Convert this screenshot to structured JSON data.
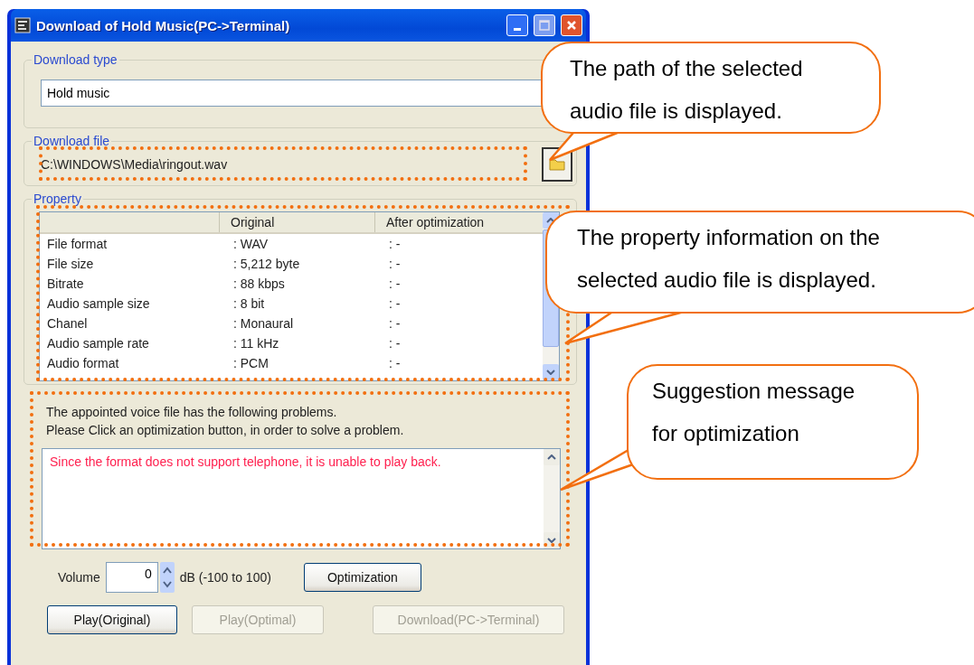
{
  "window": {
    "title": "Download of Hold Music(PC->Terminal)"
  },
  "download_type": {
    "label": "Download type",
    "value": "Hold music"
  },
  "download_file": {
    "label": "Download file",
    "path": "C:\\WINDOWS\\Media\\ringout.wav"
  },
  "property": {
    "label": "Property",
    "columns": [
      "Original",
      "After optimization"
    ],
    "rows": [
      {
        "name": "File format",
        "original": ": WAV",
        "after": ": -"
      },
      {
        "name": "File size",
        "original": ": 5,212 byte",
        "after": ": -"
      },
      {
        "name": "Bitrate",
        "original": ": 88 kbps",
        "after": ": -"
      },
      {
        "name": "Audio sample size",
        "original": ": 8 bit",
        "after": ": -"
      },
      {
        "name": "Chanel",
        "original": ": Monaural",
        "after": ": -"
      },
      {
        "name": "Audio sample rate",
        "original": ": 11 kHz",
        "after": ": -"
      },
      {
        "name": "Audio format",
        "original": ": PCM",
        "after": ": -"
      }
    ]
  },
  "message": {
    "lines": [
      "The appointed voice file has the following problems.",
      "Please Click an optimization button, in order to solve a problem."
    ],
    "problem": "Since the format does not support telephone, it is unable to play back."
  },
  "volume": {
    "label": "Volume",
    "value": "0",
    "unit": "dB (-100 to 100)"
  },
  "optimize_button": {
    "label": "Optimization",
    "disabled": false
  },
  "action_buttons": [
    {
      "label": "Play(Original)",
      "disabled": false
    },
    {
      "label": "Play(Optimal)",
      "disabled": true
    },
    {
      "label": "Download(PC->Terminal)",
      "disabled": true
    }
  ],
  "callouts": [
    {
      "lines": [
        "The path of the selected",
        "audio file is displayed."
      ]
    },
    {
      "lines": [
        "The property information on the",
        "selected audio file is displayed."
      ]
    },
    {
      "lines": [
        "Suggestion message",
        "for optimization"
      ]
    }
  ]
}
